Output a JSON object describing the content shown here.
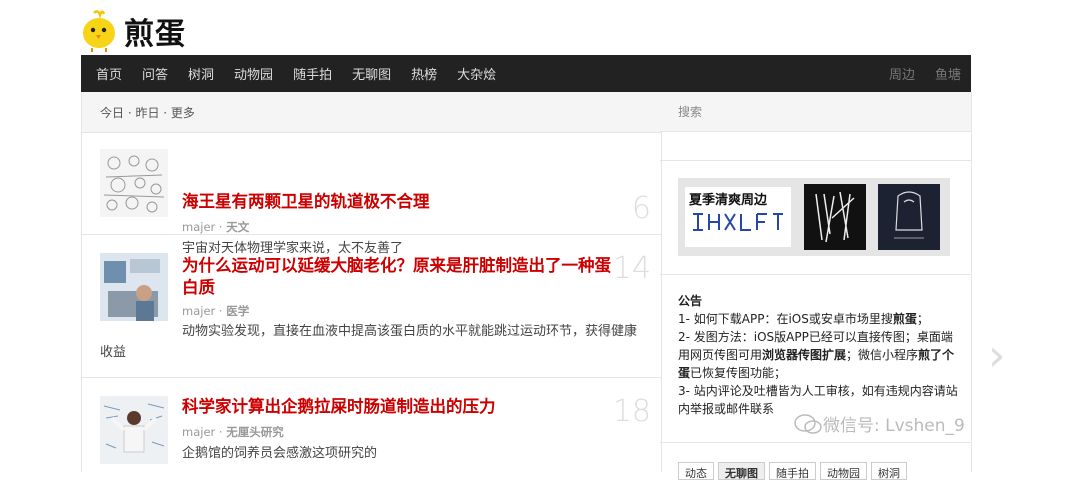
{
  "site": {
    "logo_text": "煎蛋"
  },
  "nav": {
    "left": [
      "首页",
      "问答",
      "树洞",
      "动物园",
      "随手拍",
      "无聊图",
      "热榜",
      "大杂烩"
    ],
    "right": [
      "周边",
      "鱼塘"
    ]
  },
  "tabs": "今日 · 昨日 · 更多",
  "posts": [
    {
      "title": "海王星有两颗卫星的轨道极不合理",
      "author": "majer",
      "tag": "天文",
      "desc": "宇宙对天体物理学家来说，太不友善了",
      "num": "6"
    },
    {
      "title": "为什么运动可以延缓大脑老化？原来是肝脏制造出了一种蛋白质",
      "author": "majer",
      "tag": "医学",
      "desc": "动物实验发现，直接在血液中提高该蛋白质的水平就能跳过运动环节，获得健康收益",
      "num": "14"
    },
    {
      "title": "科学家计算出企鹅拉屎时肠道制造出的压力",
      "author": "majer",
      "tag": "无厘头研究",
      "desc": "企鹅馆的饲养员会感激这项研究的",
      "num": "18"
    }
  ],
  "sidebar": {
    "search_placeholder": "搜索",
    "banner_text": "夏季清爽周边",
    "notice_title": "公告",
    "notice_1a": "1- 如何下载APP：在iOS或安卓市场里搜",
    "notice_1b": "煎蛋",
    "notice_1c": "；",
    "notice_2a": "2- 发图方法：iOS版APP已经可以直接传图；桌面端用网页传图可用",
    "notice_2b": "浏览器传图扩展",
    "notice_2c": "；微信小程序",
    "notice_2d": "煎了个蛋",
    "notice_2e": "已恢复传图功能；",
    "notice_3": "3- 站内评论及吐槽皆为人工审核，如有违规内容请站内举报或邮件联系",
    "bottom_tabs": [
      "动态",
      "无聊图",
      "随手拍",
      "动物园",
      "树洞"
    ]
  },
  "watermark": "微信号: Lvshen_9"
}
